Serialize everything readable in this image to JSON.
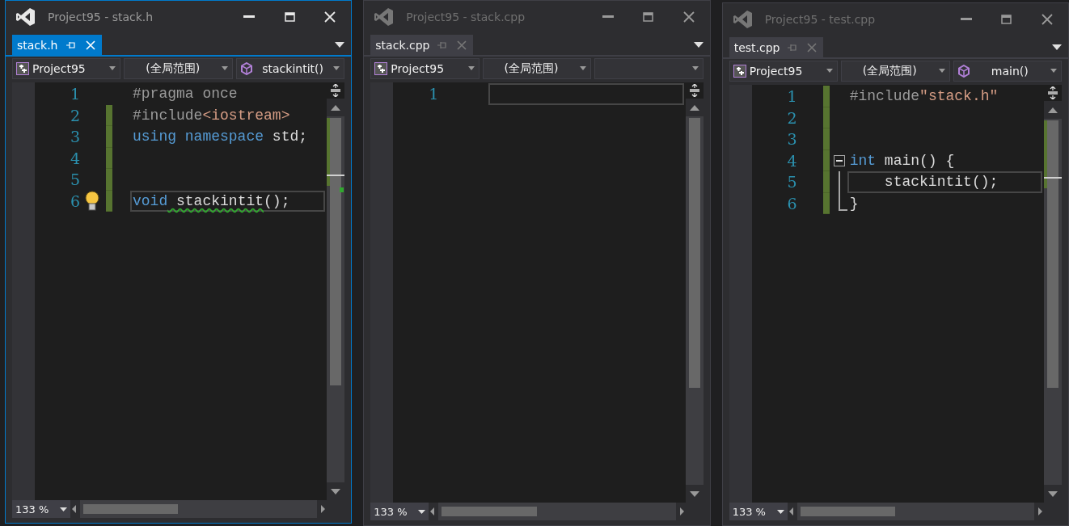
{
  "windows": [
    {
      "title": "Project95 - stack.h",
      "active": true,
      "tab": {
        "label": "stack.h",
        "selected": true
      },
      "nav": {
        "project": "Project95",
        "scope": "(全局范围)",
        "member": "stackintit()"
      },
      "lines": [
        {
          "number": "1",
          "changed": false,
          "current": false,
          "lightbulb": false,
          "tokens": [
            {
              "text": "#pragma once",
              "kind": "preproc"
            }
          ]
        },
        {
          "number": "2",
          "changed": true,
          "current": false,
          "lightbulb": false,
          "tokens": [
            {
              "text": "#include",
              "kind": "preproc"
            },
            {
              "text": "<iostream>",
              "kind": "string"
            }
          ]
        },
        {
          "number": "3",
          "changed": true,
          "current": false,
          "lightbulb": false,
          "tokens": [
            {
              "text": "using namespace",
              "kind": "keyword"
            },
            {
              "text": " std;",
              "kind": "plain"
            }
          ]
        },
        {
          "number": "4",
          "changed": true,
          "current": false,
          "lightbulb": false
        },
        {
          "number": "5",
          "changed": true,
          "current": false,
          "lightbulb": false
        },
        {
          "number": "6",
          "changed": true,
          "current": true,
          "lightbulb": true,
          "tokens": [
            {
              "text": "void",
              "kind": "keyword"
            },
            {
              "text": " stackintit",
              "kind": "warning"
            },
            {
              "text": "();",
              "kind": "plain"
            }
          ]
        }
      ],
      "zoom": "133 %"
    },
    {
      "title": "Project95 - stack.cpp",
      "active": false,
      "tab": {
        "label": "stack.cpp",
        "selected": false
      },
      "nav": {
        "project": "Project95",
        "scope": "(全局范围)"
      },
      "lines": [
        {
          "number": "1",
          "changed": false,
          "current": true,
          "lightbulb": false
        }
      ],
      "zoom": "133 %"
    },
    {
      "title": "Project95 - test.cpp",
      "active": false,
      "tab": {
        "label": "test.cpp",
        "selected": false
      },
      "nav": {
        "project": "Project95",
        "scope": "(全局范围)",
        "member": "main()"
      },
      "lines": [
        {
          "number": "1",
          "changed": true,
          "current": false,
          "lightbulb": false,
          "tokens": [
            {
              "text": "#include",
              "kind": "preproc"
            },
            {
              "text": "\"stack.h\"",
              "kind": "string"
            }
          ]
        },
        {
          "number": "2",
          "changed": true,
          "current": false,
          "lightbulb": false
        },
        {
          "number": "3",
          "changed": true,
          "current": false,
          "lightbulb": false
        },
        {
          "number": "4",
          "changed": true,
          "current": false,
          "lightbulb": false,
          "expanded": true,
          "tokens": [
            {
              "text": "int",
              "kind": "keyword"
            },
            {
              "text": " main() {",
              "kind": "plain"
            }
          ],
          "children": [
            {
              "number": "5",
              "changed": true,
              "current": true,
              "lightbulb": false,
              "tokens": [
                {
                  "text": "    stackintit();",
                  "kind": "plain"
                }
              ]
            },
            {
              "number": "6",
              "changed": true,
              "current": false,
              "lightbulb": false,
              "tokens": [
                {
                  "text": "}",
                  "kind": "plain"
                }
              ]
            }
          ]
        }
      ],
      "zoom": "133 %"
    }
  ]
}
